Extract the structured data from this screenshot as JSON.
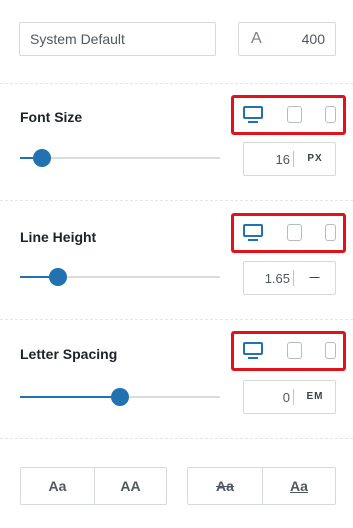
{
  "font_family": {
    "value": "System Default"
  },
  "font_weight": {
    "icon": "A",
    "value": "400"
  },
  "font_size": {
    "label": "Font Size",
    "value": "16",
    "unit": "PX",
    "slider_fraction": 0.11
  },
  "line_height": {
    "label": "Line Height",
    "value": "1.65",
    "unit": "—",
    "slider_fraction": 0.19
  },
  "letter_spacing": {
    "label": "Letter Spacing",
    "value": "0",
    "unit": "EM",
    "slider_fraction": 0.5
  },
  "text_transform": {
    "capitalize": "Aa",
    "uppercase": "AA"
  },
  "text_decoration": {
    "line_through": "Aa",
    "underline": "Aa"
  },
  "devices": [
    "desktop-icon",
    "tablet-icon",
    "mobile-icon"
  ],
  "colors": {
    "accent": "#2271b1",
    "highlight": "#e0121c"
  }
}
